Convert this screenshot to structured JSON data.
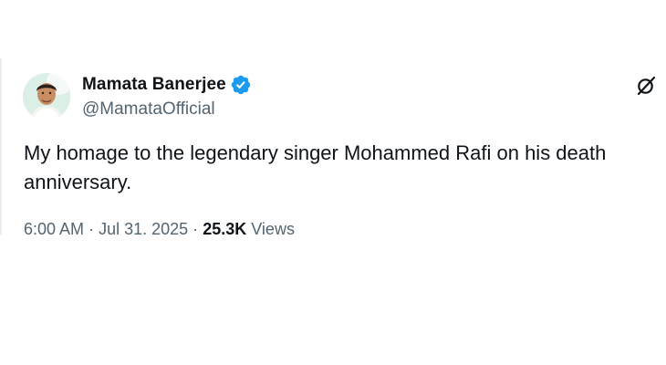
{
  "tweet": {
    "author": {
      "display_name": "Mamata Banerjee",
      "handle": "@MamataOfficial",
      "verified": true
    },
    "text": "My homage to the legendary singer Mohammed Rafi on his death anniversary.",
    "meta": {
      "time": "6:00 AM",
      "separator": "·",
      "date": "Jul 31, 2025",
      "views_count": "25.3K",
      "views_label": "Views"
    }
  },
  "icons": {
    "verified": "verified-badge-icon",
    "grok": "grok-icon"
  },
  "colors": {
    "verified_blue": "#1d9bf0",
    "text_primary": "#0f1419",
    "text_secondary": "#536471"
  }
}
